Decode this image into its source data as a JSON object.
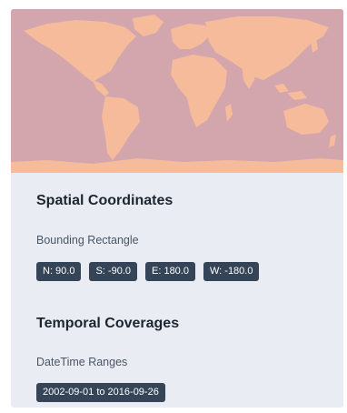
{
  "spatial": {
    "title": "Spatial Coordinates",
    "bounding_label": "Bounding Rectangle",
    "north": "N: 90.0",
    "south": "S: -90.0",
    "east": "E: 180.0",
    "west": "W: -180.0"
  },
  "temporal": {
    "title": "Temporal Coverages",
    "range_label": "DateTime Ranges",
    "range": "2002-09-01 to 2016-09-26"
  },
  "colors": {
    "ocean": "#d3a6ad",
    "land": "#f5bb9b",
    "chip_bg": "#354457",
    "card_bg": "#e9edf3"
  }
}
